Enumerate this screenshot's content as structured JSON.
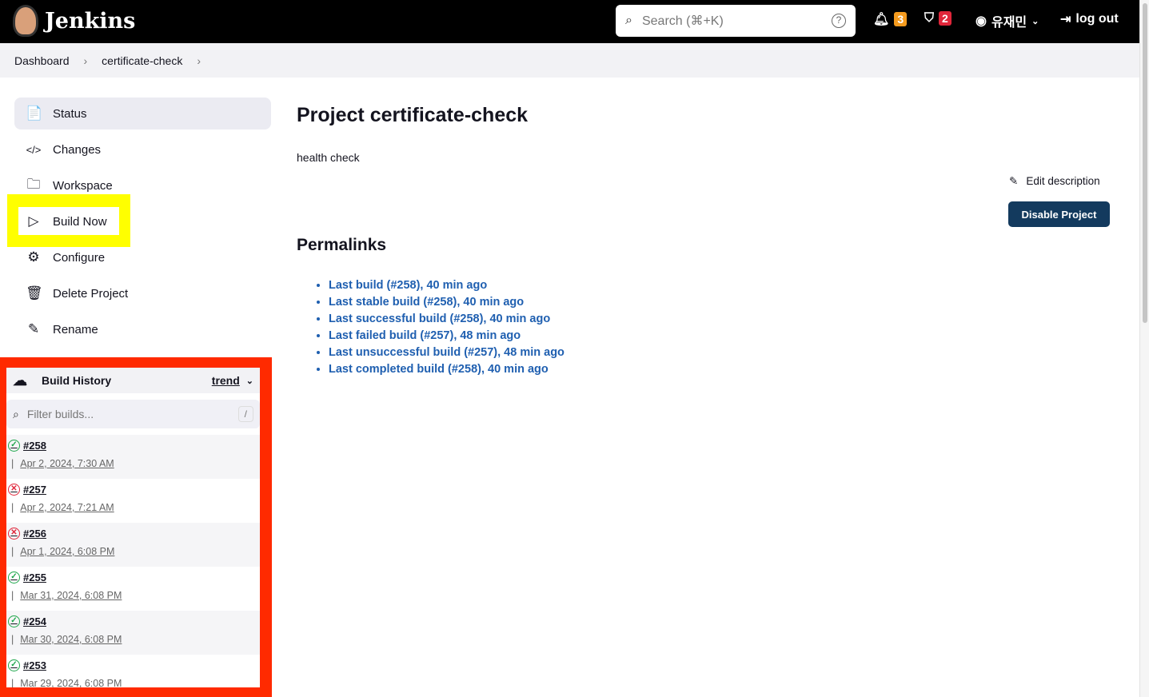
{
  "header": {
    "app": "Jenkins",
    "search_placeholder": "Search (⌘+K)",
    "help": "?",
    "notifications": "3",
    "security": "2",
    "user": "유재민",
    "logout": "log out"
  },
  "breadcrumb": [
    "Dashboard",
    "certificate-check"
  ],
  "sidebar": {
    "items": [
      {
        "label": "Status",
        "icon": "📄"
      },
      {
        "label": "Changes",
        "icon": "</>"
      },
      {
        "label": "Workspace",
        "icon": "🗀"
      },
      {
        "label": "Build Now",
        "icon": "▷"
      },
      {
        "label": "Configure",
        "icon": "⚙"
      },
      {
        "label": "Delete Project",
        "icon": "🗑"
      },
      {
        "label": "Rename",
        "icon": "✎"
      }
    ]
  },
  "history": {
    "title": "Build History",
    "trend": "trend",
    "filter_placeholder": "Filter builds...",
    "shortcut": "/",
    "builds": [
      {
        "id": "#258",
        "date": "Apr 2, 2024, 7:30 AM",
        "status": "success"
      },
      {
        "id": "#257",
        "date": "Apr 2, 2024, 7:21 AM",
        "status": "failed"
      },
      {
        "id": "#256",
        "date": "Apr 1, 2024, 6:08 PM",
        "status": "failed"
      },
      {
        "id": "#255",
        "date": "Mar 31, 2024, 6:08 PM",
        "status": "success"
      },
      {
        "id": "#254",
        "date": "Mar 30, 2024, 6:08 PM",
        "status": "success"
      },
      {
        "id": "#253",
        "date": "Mar 29, 2024, 6:08 PM",
        "status": "success"
      }
    ]
  },
  "main": {
    "title": "Project certificate-check",
    "description": "health check",
    "edit_description": "Edit description",
    "disable": "Disable Project",
    "permalinks_title": "Permalinks",
    "permalinks": [
      "Last build (#258), 40 min ago",
      "Last stable build (#258), 40 min ago",
      "Last successful build (#258), 40 min ago",
      "Last failed build (#257), 48 min ago",
      "Last unsuccessful build (#257), 48 min ago",
      "Last completed build (#258), 40 min ago"
    ]
  },
  "colors": {
    "success": "#1ea64b",
    "failed": "#e0263a",
    "notif": "#f59b1e",
    "security": "#e0263a",
    "highlight_build_now": "#ffff00",
    "highlight_history": "#ff2a00"
  }
}
